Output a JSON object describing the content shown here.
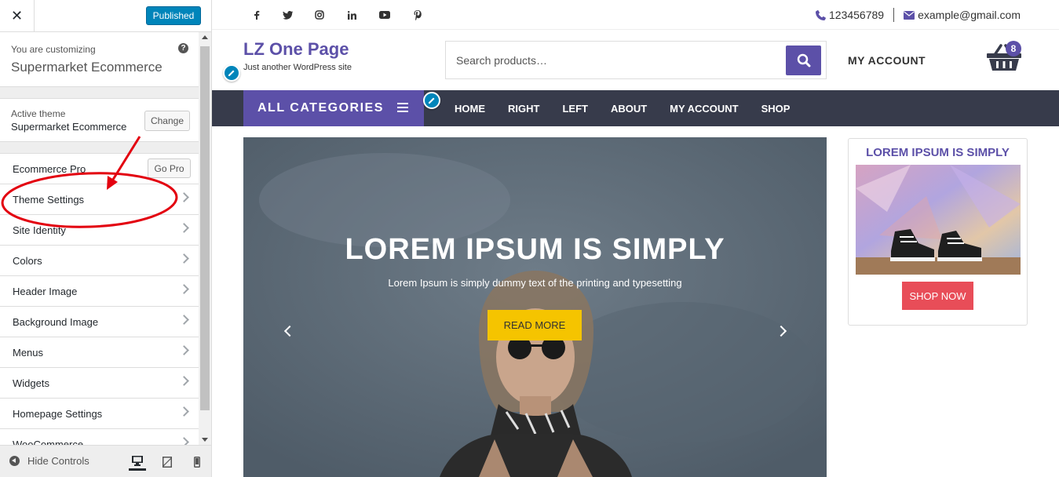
{
  "customizer": {
    "close_symbol": "✕",
    "publish_label": "Published",
    "customizing_label": "You are customizing",
    "site_name": "Supermarket Ecommerce",
    "help_symbol": "?",
    "active_theme_label": "Active theme",
    "active_theme_name": "Supermarket Ecommerce",
    "change_label": "Change",
    "go_pro_label": "Go Pro",
    "menu": [
      {
        "label": "Ecommerce Pro"
      },
      {
        "label": "Theme Settings"
      },
      {
        "label": "Site Identity"
      },
      {
        "label": "Colors"
      },
      {
        "label": "Header Image"
      },
      {
        "label": "Background Image"
      },
      {
        "label": "Menus"
      },
      {
        "label": "Widgets"
      },
      {
        "label": "Homepage Settings"
      },
      {
        "label": "WooCommerce"
      }
    ],
    "hide_controls_label": "Hide Controls",
    "devices": [
      "desktop-icon",
      "tablet-icon",
      "mobile-icon"
    ],
    "annotation_color": "#e3000f"
  },
  "site": {
    "social_icons": [
      "facebook-icon",
      "twitter-icon",
      "instagram-icon",
      "linkedin-icon",
      "youtube-icon",
      "pinterest-icon"
    ],
    "phone": "123456789",
    "email": "example@gmail.com",
    "title": "LZ One Page",
    "tagline": "Just another WordPress site",
    "search_placeholder": "Search products…",
    "my_account": "MY ACCOUNT",
    "cart_count": "8",
    "all_categories": "ALL CATEGORIES",
    "nav": [
      "HOME",
      "RIGHT",
      "LEFT",
      "ABOUT",
      "MY ACCOUNT",
      "SHOP"
    ],
    "slide": {
      "title": "LOREM IPSUM IS SIMPLY",
      "text": "Lorem Ipsum is simply dummy text of the printing and typesetting",
      "button": "READ MORE"
    },
    "promo": {
      "title": "LOREM IPSUM IS SIMPLY",
      "button": "SHOP NOW"
    },
    "colors": {
      "brand_purple": "#5c50a8",
      "nav_dark": "#373b4b",
      "read_more_yellow": "#f5c400",
      "shop_now_red": "#e84d58",
      "publish_blue": "#0085ba"
    }
  }
}
